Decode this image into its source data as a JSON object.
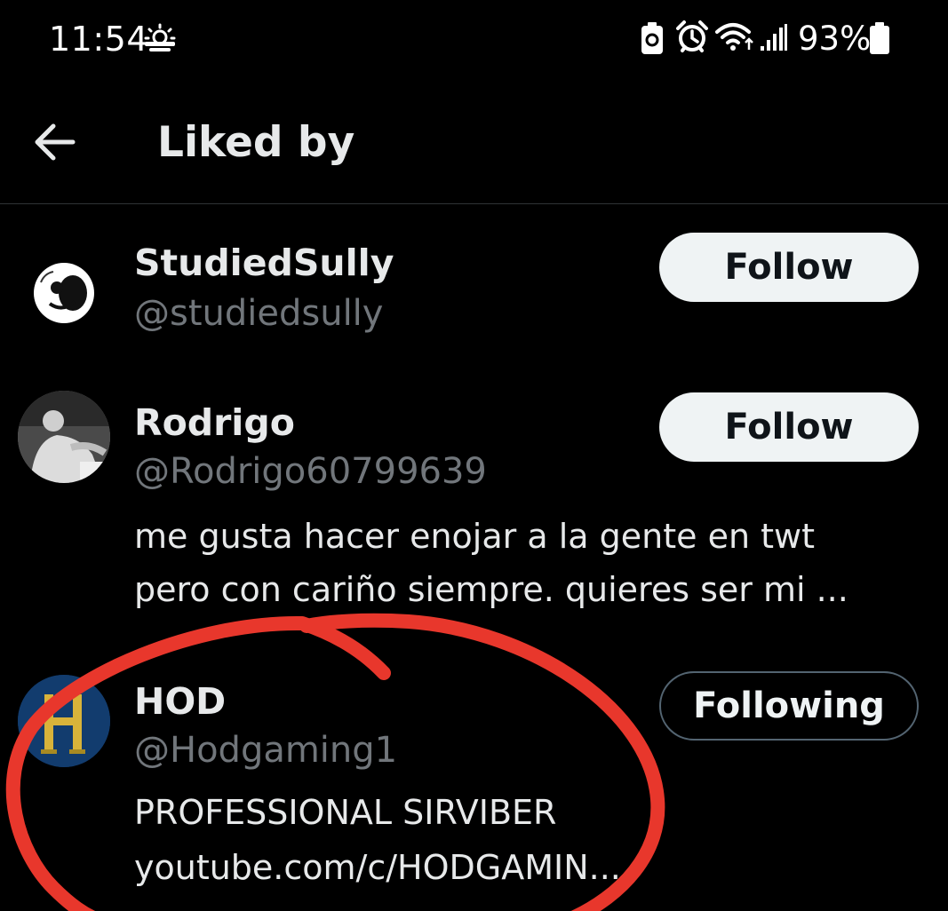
{
  "status_bar": {
    "time": "11:54",
    "battery": "93%",
    "icons": [
      "weather-sun-cloud-icon",
      "battery-saver-icon",
      "alarm-icon",
      "wifi-icon",
      "signal-icon",
      "battery-icon"
    ]
  },
  "header": {
    "back_icon": "arrow-left-icon",
    "title": "Liked by"
  },
  "users": [
    {
      "name": "StudiedSully",
      "handle": "@studiedsully",
      "button": "Follow",
      "bio": []
    },
    {
      "name": "Rodrigo",
      "handle": "@Rodrigo60799639",
      "button": "Follow",
      "bio": [
        "me gusta hacer enojar a la gente en twt",
        "pero con cariño siempre. quieres ser mi ..."
      ]
    },
    {
      "name": "HOD",
      "handle": "@Hodgaming1",
      "button": "Following",
      "bio": [
        "PROFESSIONAL SIRVIBER",
        "youtube.com/c/HODGAMIN..."
      ]
    }
  ],
  "colors": {
    "background": "#000000",
    "text": "#e7e9ea",
    "muted": "#71767b",
    "annotation": "#e8372c"
  }
}
